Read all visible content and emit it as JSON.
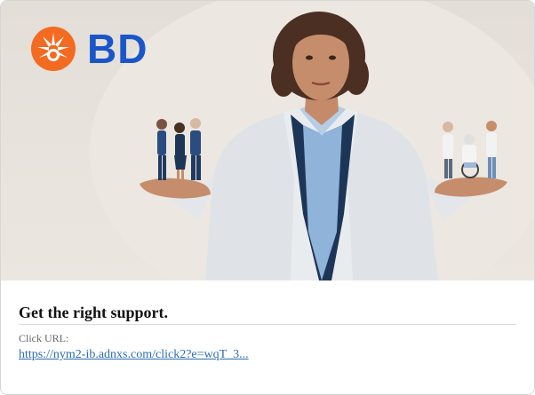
{
  "ad": {
    "brand": {
      "logo_text": "BD",
      "logo_icon": "sunburst-logo-icon",
      "orange": "#F26B21",
      "blue": "#1A56C9"
    },
    "hero_image": {
      "icon": "doctor-holding-figures-image"
    },
    "headline": "Get the right support.",
    "url_label": "Click URL:",
    "url_text": "https://nym2-ib.adnxs.com/click2?e=wqT_3...",
    "link_color": "#2b6cb0"
  }
}
